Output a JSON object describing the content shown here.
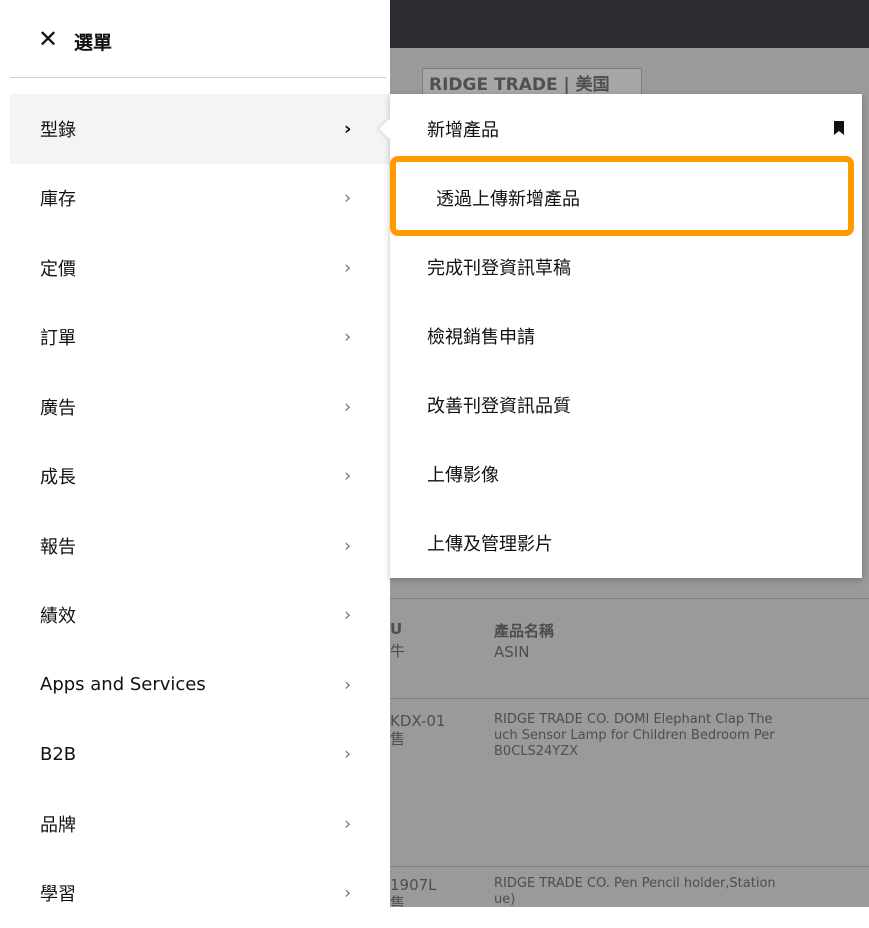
{
  "background": {
    "store_name": "RIDGE TRADE | 美国",
    "table_headers": {
      "sku": "U",
      "sku_sub": "牛",
      "product_name": "產品名稱",
      "product_name_sub": "ASIN"
    },
    "rows": [
      {
        "sku": "KDX-01",
        "sku_sub": "售",
        "title_line1": "RIDGE TRADE CO. DOMI Elephant Clap The",
        "title_line2": "uch Sensor Lamp for Children Bedroom Per",
        "asin": "B0CLS24YZX"
      },
      {
        "sku": "1907L",
        "sku_sub": "售",
        "title_line1": "RIDGE TRADE CO. Pen Pencil holder,Station",
        "title_line2": "ue)"
      }
    ]
  },
  "drawer": {
    "title": "選單",
    "close_icon": "close-icon",
    "items": [
      {
        "label": "型錄",
        "active": true
      },
      {
        "label": "庫存"
      },
      {
        "label": "定價"
      },
      {
        "label": "訂單"
      },
      {
        "label": "廣告"
      },
      {
        "label": "成長"
      },
      {
        "label": "報告"
      },
      {
        "label": "績效"
      },
      {
        "label": "Apps and Services"
      },
      {
        "label": "B2B"
      },
      {
        "label": "品牌"
      },
      {
        "label": "學習"
      }
    ],
    "chevron": "›"
  },
  "flyout": {
    "items": [
      {
        "label": "新增產品",
        "bookmarked": true
      },
      {
        "label": "透過上傳新增產品",
        "highlighted": true
      },
      {
        "label": "完成刊登資訊草稿"
      },
      {
        "label": "檢視銷售申請"
      },
      {
        "label": "改善刊登資訊品質"
      },
      {
        "label": "上傳影像"
      },
      {
        "label": "上傳及管理影片"
      }
    ],
    "highlight_color": "#ff9a00"
  }
}
